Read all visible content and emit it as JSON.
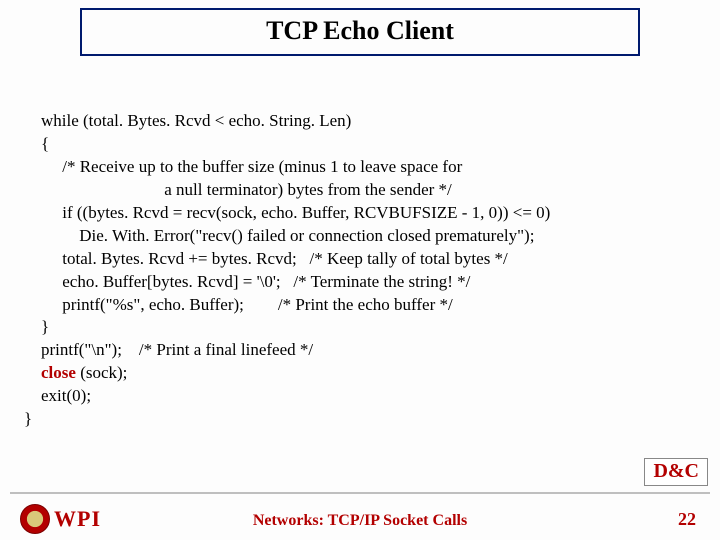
{
  "title": "TCP Echo Client",
  "code": {
    "l1": "    while (total. Bytes. Rcvd < echo. String. Len)",
    "l2": "    {",
    "l3": "         /* Receive up to the buffer size (minus 1 to leave space for",
    "l4": "                                 a null terminator) bytes from the sender */",
    "l5": "         if ((bytes. Rcvd = recv(sock, echo. Buffer, RCVBUFSIZE - 1, 0)) <= 0)",
    "l6": "             Die. With. Error(\"recv() failed or connection closed prematurely\");",
    "l7": "         total. Bytes. Rcvd += bytes. Rcvd;   /* Keep tally of total bytes */",
    "l8": "         echo. Buffer[bytes. Rcvd] = '\\0';   /* Terminate the string! */",
    "l9": "         printf(\"%s\", echo. Buffer);        /* Print the echo buffer */",
    "l10": "    }",
    "l11": "    printf(\"\\n\");    /* Print a final linefeed */",
    "l12a": "    ",
    "l12b": "close",
    "l12c": " (sock);",
    "l13": "    exit(0);",
    "l14": "}"
  },
  "dc_label": "D&C",
  "footer": {
    "logo_text": "WPI",
    "center": "Networks: TCP/IP Socket Calls",
    "page": "22"
  }
}
